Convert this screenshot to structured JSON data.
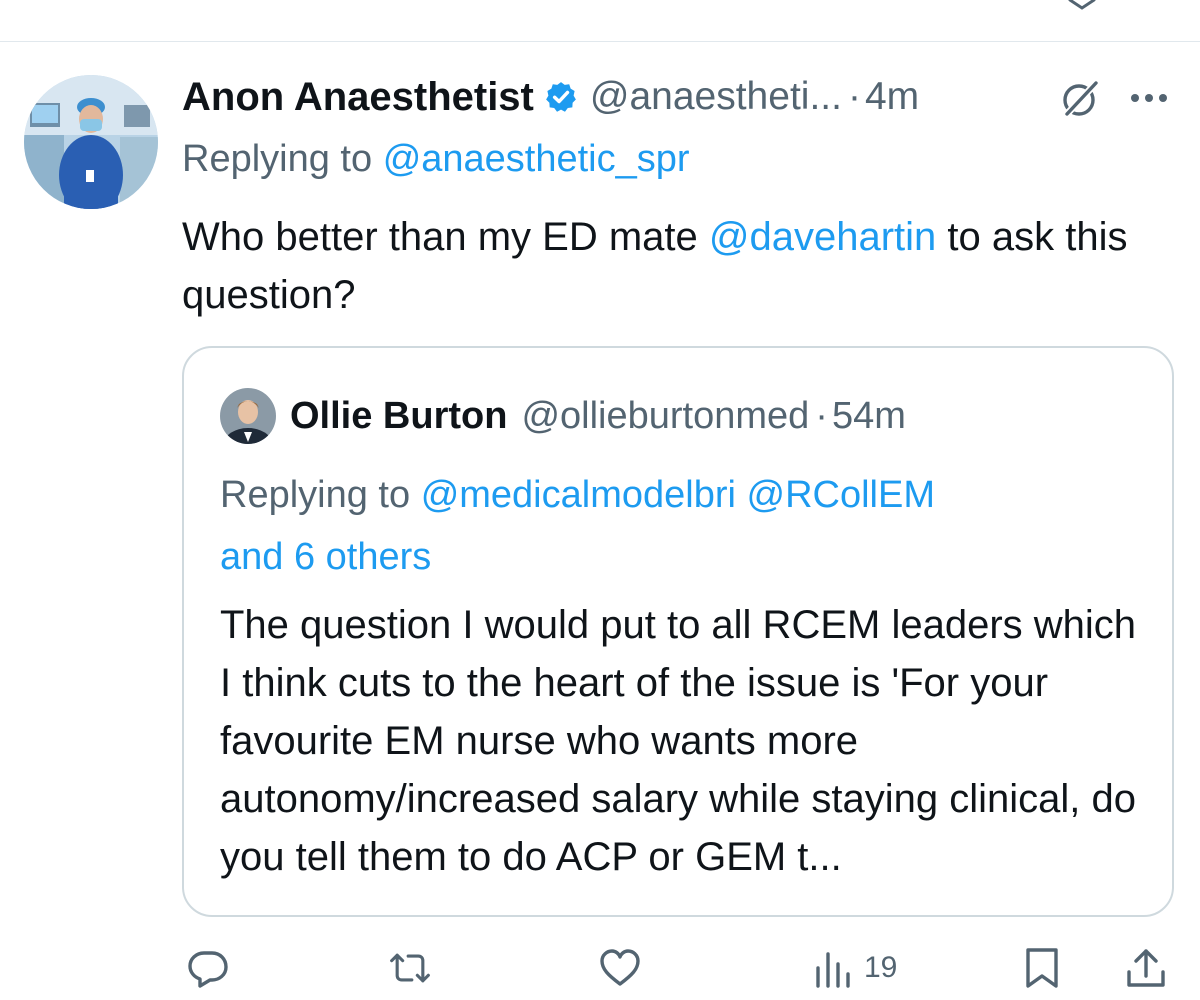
{
  "tweet": {
    "display_name": "Anon Anaesthetist",
    "handle": "@anaestheti...",
    "separator": "·",
    "time": "4m",
    "replying_prefix": "Replying to",
    "replying_to": "@anaesthetic_spr",
    "text_part1": "Who better than my ED mate ",
    "text_mention": "@davehartin",
    "text_part2": " to ask this question?"
  },
  "quote": {
    "display_name": "Ollie Burton",
    "handle": "@ollieburtonmed",
    "separator": "·",
    "time": "54m",
    "replying_prefix": "Replying to",
    "mention1": "@medicalmodelbri",
    "mention2": "@RCollEM",
    "others": "and 6 others",
    "text": "The question I would put to all RCEM leaders which I think cuts to the heart of the issue is 'For your favourite EM nurse who wants more autonomy/increased salary while staying clinical, do you tell them to do ACP or GEM t..."
  },
  "actions": {
    "views_count": "19"
  },
  "icons": {
    "verified": "verified-badge-icon",
    "grok": "grok-icon",
    "more": "more-icon",
    "reply": "reply-icon",
    "retweet": "retweet-icon",
    "like": "like-icon",
    "views": "views-icon",
    "bookmark": "bookmark-icon",
    "share": "share-icon"
  },
  "colors": {
    "link": "#1d9bf0",
    "secondary_text": "#536471",
    "primary_text": "#0f1419",
    "border": "#cfd9de"
  }
}
